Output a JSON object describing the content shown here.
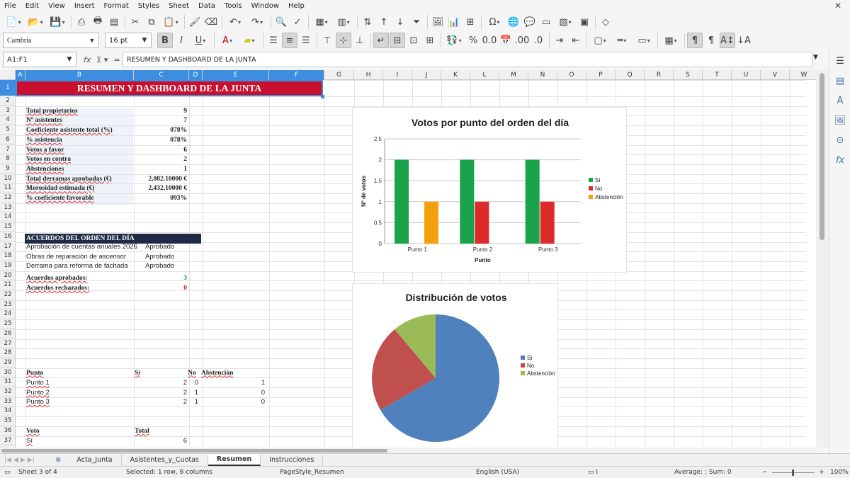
{
  "menu": [
    "File",
    "Edit",
    "View",
    "Insert",
    "Format",
    "Styles",
    "Sheet",
    "Data",
    "Tools",
    "Window",
    "Help"
  ],
  "toolbar": {
    "font_name": "Cambria",
    "font_size": "16 pt"
  },
  "formula_bar": {
    "name_box": "A1:F1",
    "content": "RESUMEN Y DASHBOARD DE LA JUNTA"
  },
  "columns": [
    "A",
    "B",
    "C",
    "D",
    "E",
    "F",
    "G",
    "H",
    "I",
    "J",
    "K",
    "L",
    "M",
    "N",
    "O",
    "P",
    "Q",
    "R",
    "S",
    "T",
    "U",
    "V",
    "W"
  ],
  "rows": [
    "1",
    "2",
    "3",
    "4",
    "5",
    "6",
    "7",
    "8",
    "9",
    "10",
    "11",
    "12",
    "13",
    "14",
    "15",
    "16",
    "17",
    "18",
    "19",
    "20",
    "21",
    "22",
    "23",
    "24",
    "25",
    "26",
    "27",
    "28",
    "29",
    "30",
    "31",
    "32",
    "33",
    "34",
    "35",
    "36",
    "37"
  ],
  "sheet": {
    "title": "RESUMEN Y DASHBOARD DE LA JUNTA",
    "summary": [
      {
        "label": "Total propietarios",
        "value": "9"
      },
      {
        "label": "Nº asistentes",
        "value": "7"
      },
      {
        "label": "Coeficiente asistente total (%)",
        "value": "078%"
      },
      {
        "label": "% asistencia",
        "value": "078%"
      },
      {
        "label": "Votos a favor",
        "value": "6"
      },
      {
        "label": "Votos en contra",
        "value": "2"
      },
      {
        "label": "Abstenciones",
        "value": "1"
      },
      {
        "label": "Total derramas aprobadas (€)",
        "value": "2,082.10000 €"
      },
      {
        "label": "Morosidad estimada (€)",
        "value": "2,432.10000 €"
      },
      {
        "label": "% coeficiente favorable",
        "value": "093%"
      }
    ],
    "acuerdos_header": "ACUERDOS DEL ORDEN DEL DÍA",
    "acuerdos": [
      {
        "label": "Aprobación de cuentas anuales 2026",
        "status": "Aprobado"
      },
      {
        "label": "Obras de reparación de ascensor",
        "status": "Aprobado"
      },
      {
        "label": "Derrama para reforma de fachada",
        "status": "Aprobado"
      }
    ],
    "aprobados_label": "Acuerdos aprobados:",
    "aprobados_value": "3",
    "rechazados_label": "Acuerdos rechazados:",
    "rechazados_value": "0",
    "vote_table": {
      "headers": [
        "Punto",
        "Sí",
        "No",
        "Abstención"
      ],
      "rows": [
        [
          "Punto 1",
          "2",
          "0",
          "1"
        ],
        [
          "Punto 2",
          "2",
          "1",
          "0"
        ],
        [
          "Punto 3",
          "2",
          "1",
          "0"
        ]
      ]
    },
    "voto_headers": [
      "Voto",
      "Total"
    ],
    "voto_rows": [
      [
        "Sí",
        "6"
      ]
    ]
  },
  "chart_data": [
    {
      "type": "bar",
      "title": "Votos por punto del orden del día",
      "xlabel": "Punto",
      "ylabel": "Nº de votos",
      "categories": [
        "Punto 1",
        "Punto 2",
        "Punto 3"
      ],
      "series": [
        {
          "name": "Sí",
          "values": [
            2,
            2,
            2
          ],
          "color": "#1aa34a"
        },
        {
          "name": "No",
          "values": [
            0,
            1,
            1
          ],
          "color": "#dd2a2a"
        },
        {
          "name": "Abstención",
          "values": [
            1,
            0,
            0
          ],
          "color": "#f4a00e"
        }
      ],
      "yticks": [
        "0",
        "0.5",
        "1",
        "1.5",
        "2",
        "2.5"
      ],
      "ylim": [
        0,
        2.5
      ],
      "grid": true,
      "legend": "right"
    },
    {
      "type": "pie",
      "title": "Distribución de votos",
      "categories": [
        "Sí",
        "No",
        "Abstención"
      ],
      "values": [
        6,
        2,
        1
      ],
      "colors": [
        "#4f81bd",
        "#c0504d",
        "#9bbb59"
      ],
      "legend": "right"
    }
  ],
  "tabs": [
    "Acta_Junta",
    "Asistentes_y_Cuotas",
    "Resumen",
    "Instrucciones"
  ],
  "active_tab": "Resumen",
  "status": {
    "sheet": "Sheet 3 of 4",
    "selection": "Selected: 1 row, 6 columns",
    "page_style": "PageStyle_Resumen",
    "language": "English (USA)",
    "sum": "Average: ; Sum: 0",
    "zoom": "100%"
  }
}
